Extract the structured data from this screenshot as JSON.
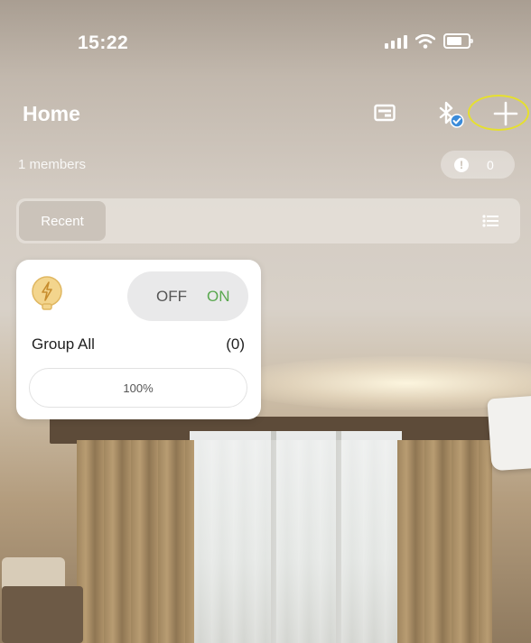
{
  "status_bar": {
    "time": "15:22",
    "icons": [
      "signal-icon",
      "wifi-icon",
      "battery-icon"
    ]
  },
  "header": {
    "title": "Home",
    "icons": [
      "screen-icon",
      "bluetooth-check-icon",
      "add-icon"
    ]
  },
  "members": {
    "label": "1 members",
    "alert_count": "0",
    "alert_icon": "exclamation-icon"
  },
  "tabs": {
    "active": "Recent",
    "list_icon": "list-icon"
  },
  "group_card": {
    "icon": "lightning-bulb-icon",
    "toggle_off": "OFF",
    "toggle_on": "ON",
    "name": "Group All",
    "count": "(0)",
    "brightness": "100%"
  },
  "colors": {
    "highlight": "#e6e02d",
    "on_green": "#5aa84f",
    "bulb_fill": "#f3d58d"
  }
}
